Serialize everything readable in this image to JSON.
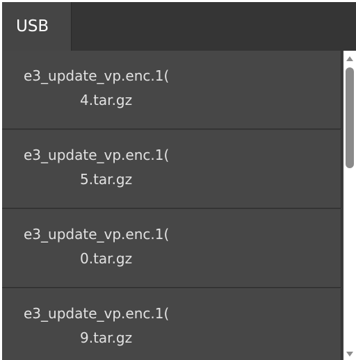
{
  "tabs": [
    {
      "label": "USB"
    }
  ],
  "files": [
    {
      "line1": "e3_update_vp.enc.1(",
      "line2_lead": "4",
      "line2": "4.tar.gz"
    },
    {
      "line1": "e3_update_vp.enc.1(",
      "line2_lead": "5",
      "line2": "5.tar.gz"
    },
    {
      "line1": "e3_update_vp.enc.1(",
      "line2_lead": "0",
      "line2": "0.tar.gz"
    },
    {
      "line1": "e3_update_vp.enc.1(",
      "line2_lead": "9",
      "line2": "9.tar.gz"
    }
  ],
  "colors": {
    "panel": "#3c3c3c",
    "item": "#474747",
    "tab_active": "#454545",
    "text": "#e2e2e2",
    "scrollbar_track": "#ffffff",
    "scrollbar_thumb": "#8a8a8a"
  },
  "icons": {
    "scroll_up": "triangle-up",
    "scroll_down": "triangle-down"
  }
}
